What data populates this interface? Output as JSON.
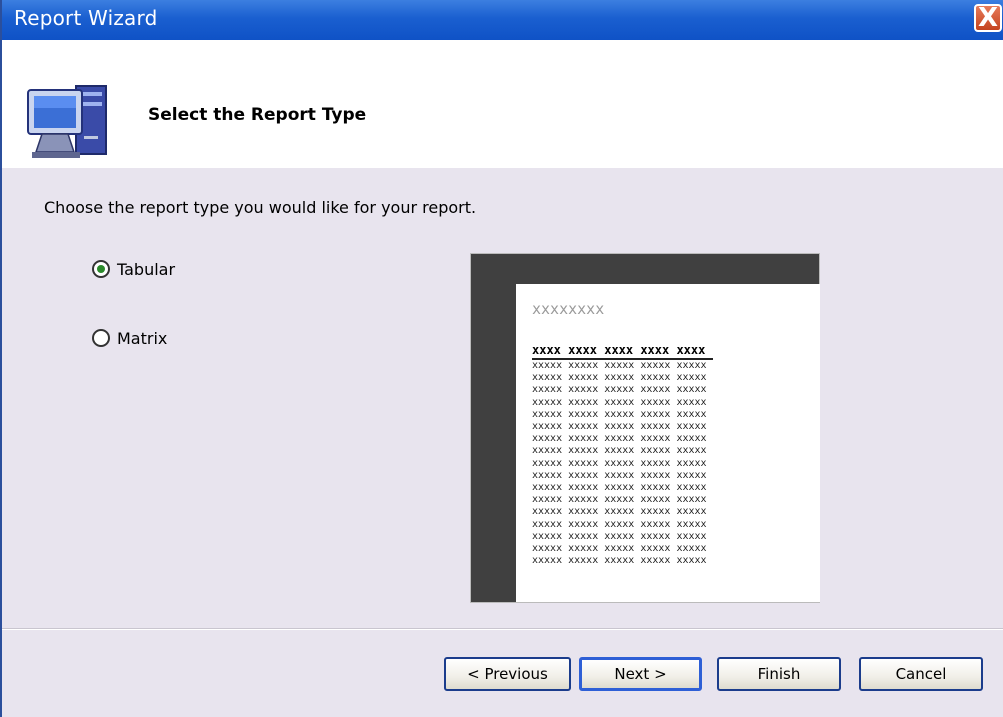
{
  "window": {
    "title": "Report Wizard",
    "close_label": "X"
  },
  "header": {
    "title": "Select the Report Type",
    "icon": "computer-icon"
  },
  "instruction": "Choose the report type you would like for your report.",
  "report_types": [
    {
      "label": "Tabular",
      "selected": true
    },
    {
      "label": "Matrix",
      "selected": false
    }
  ],
  "preview": {
    "title": "xxxxxxxx",
    "headers": [
      "xxxx",
      "xxxx",
      "xxxx",
      "xxxx",
      "xxxx"
    ],
    "rows": [
      [
        "xxxxx",
        "xxxxx",
        "xxxxx",
        "xxxxx",
        "xxxxx"
      ],
      [
        "xxxxx",
        "xxxxx",
        "xxxxx",
        "xxxxx",
        "xxxxx"
      ],
      [
        "xxxxx",
        "xxxxx",
        "xxxxx",
        "xxxxx",
        "xxxxx"
      ],
      [
        "xxxxx",
        "xxxxx",
        "xxxxx",
        "xxxxx",
        "xxxxx"
      ],
      [
        "xxxxx",
        "xxxxx",
        "xxxxx",
        "xxxxx",
        "xxxxx"
      ],
      [
        "xxxxx",
        "xxxxx",
        "xxxxx",
        "xxxxx",
        "xxxxx"
      ],
      [
        "xxxxx",
        "xxxxx",
        "xxxxx",
        "xxxxx",
        "xxxxx"
      ],
      [
        "xxxxx",
        "xxxxx",
        "xxxxx",
        "xxxxx",
        "xxxxx"
      ],
      [
        "xxxxx",
        "xxxxx",
        "xxxxx",
        "xxxxx",
        "xxxxx"
      ],
      [
        "xxxxx",
        "xxxxx",
        "xxxxx",
        "xxxxx",
        "xxxxx"
      ],
      [
        "xxxxx",
        "xxxxx",
        "xxxxx",
        "xxxxx",
        "xxxxx"
      ],
      [
        "xxxxx",
        "xxxxx",
        "xxxxx",
        "xxxxx",
        "xxxxx"
      ],
      [
        "xxxxx",
        "xxxxx",
        "xxxxx",
        "xxxxx",
        "xxxxx"
      ],
      [
        "xxxxx",
        "xxxxx",
        "xxxxx",
        "xxxxx",
        "xxxxx"
      ],
      [
        "xxxxx",
        "xxxxx",
        "xxxxx",
        "xxxxx",
        "xxxxx"
      ],
      [
        "xxxxx",
        "xxxxx",
        "xxxxx",
        "xxxxx",
        "xxxxx"
      ],
      [
        "xxxxx",
        "xxxxx",
        "xxxxx",
        "xxxxx",
        "xxxxx"
      ]
    ]
  },
  "buttons": {
    "previous": "< Previous",
    "next": "Next >",
    "finish": "Finish",
    "cancel": "Cancel"
  },
  "colors": {
    "titlebar": "#1a5fd0",
    "dialog_bg": "#e8e4ee",
    "radio_selected": "#2b8a2b"
  }
}
